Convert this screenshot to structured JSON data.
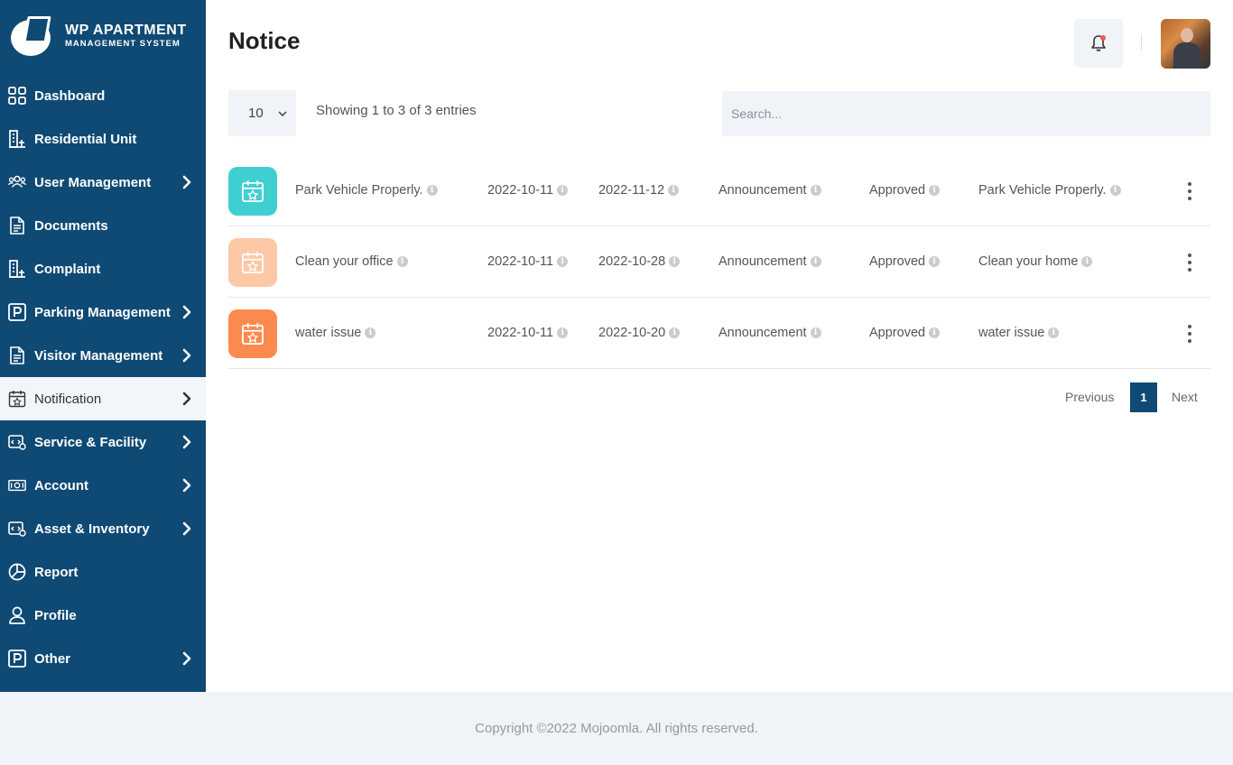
{
  "brand": {
    "title": "WP APARTMENT",
    "subtitle": "MANAGEMENT SYSTEM"
  },
  "sidebar": {
    "items": [
      {
        "label": "Dashboard",
        "icon": "dashboard-icon",
        "has_submenu": false
      },
      {
        "label": "Residential Unit",
        "icon": "building-icon",
        "has_submenu": false
      },
      {
        "label": "User Management",
        "icon": "users-icon",
        "has_submenu": true
      },
      {
        "label": "Documents",
        "icon": "document-icon",
        "has_submenu": false
      },
      {
        "label": "Complaint",
        "icon": "building-icon",
        "has_submenu": false
      },
      {
        "label": "Parking Management",
        "icon": "parking-icon",
        "has_submenu": true
      },
      {
        "label": "Visitor Management",
        "icon": "document-icon",
        "has_submenu": true
      },
      {
        "label": "Notification",
        "icon": "calendar-star-icon",
        "has_submenu": true,
        "active": true
      },
      {
        "label": "Service & Facility",
        "icon": "service-icon",
        "has_submenu": true
      },
      {
        "label": "Account",
        "icon": "money-icon",
        "has_submenu": true
      },
      {
        "label": "Asset & Inventory",
        "icon": "service-icon",
        "has_submenu": true
      },
      {
        "label": "Report",
        "icon": "pie-chart-icon",
        "has_submenu": false
      },
      {
        "label": "Profile",
        "icon": "user-icon",
        "has_submenu": false
      },
      {
        "label": "Other",
        "icon": "parking-icon",
        "has_submenu": true
      }
    ]
  },
  "header": {
    "title": "Notice",
    "bell_icon": "bell-icon",
    "notification_dot_color": "#f05a4f"
  },
  "table_controls": {
    "page_length": "10",
    "info": "Showing 1 to 3 of 3 entries",
    "search_placeholder": "Search..."
  },
  "notices": [
    {
      "icon_color": "#3fcfd1",
      "title": "Park Vehicle Properly.",
      "start_date": "2022-10-11",
      "end_date": "2022-11-12",
      "type": "Announcement",
      "status": "Approved",
      "description": "Park Vehicle Properly."
    },
    {
      "icon_color": "#fdc8a6",
      "title": "Clean your office",
      "start_date": "2022-10-11",
      "end_date": "2022-10-28",
      "type": "Announcement",
      "status": "Approved",
      "description": "Clean your home"
    },
    {
      "icon_color": "#fb8a4e",
      "title": "water issue",
      "start_date": "2022-10-11",
      "end_date": "2022-10-20",
      "type": "Announcement",
      "status": "Approved",
      "description": "water issue"
    }
  ],
  "info_glyph": "i",
  "pagination": {
    "previous": "Previous",
    "current": "1",
    "next": "Next"
  },
  "footer": {
    "text": "Copyright ©2022 Mojoomla. All rights reserved."
  },
  "colors": {
    "sidebar_bg": "#0f4a74",
    "accent": "#0f4a74"
  }
}
